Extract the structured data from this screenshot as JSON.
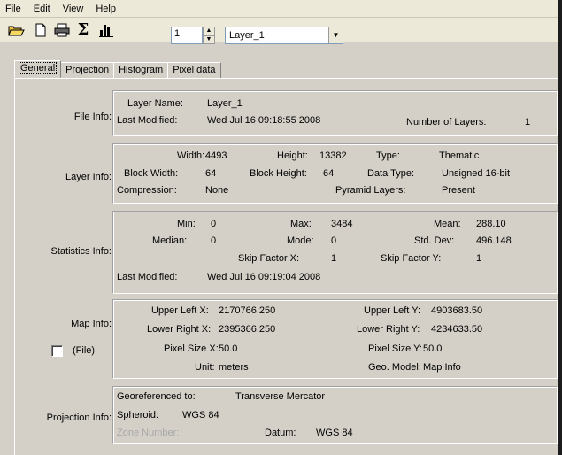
{
  "menu": [
    "File",
    "Edit",
    "View",
    "Help"
  ],
  "toolbar": {
    "open_icon": "open-folder-icon",
    "new_icon": "new-document-icon",
    "print_icon": "print-icon",
    "sigma": "Σ",
    "histogram_icon": "histogram-icon",
    "layer_number": "1",
    "layer_select": "Layer_1"
  },
  "tabs": [
    "General",
    "Projection",
    "Histogram",
    "Pixel data"
  ],
  "file_info": {
    "section": "File Info:",
    "layer_name_label": "Layer Name:",
    "layer_name": "Layer_1",
    "last_modified_label": "Last Modified:",
    "last_modified": "Wed Jul 16 09:18:55 2008",
    "num_layers_label": "Number of Layers:",
    "num_layers": "1"
  },
  "layer_info": {
    "section": "Layer Info:",
    "width_label": "Width:",
    "width": "4493",
    "height_label": "Height:",
    "height": "13382",
    "type_label": "Type:",
    "type": "Thematic",
    "block_width_label": "Block Width:",
    "block_width": "64",
    "block_height_label": "Block Height:",
    "block_height": "64",
    "data_type_label": "Data Type:",
    "data_type": "Unsigned 16-bit",
    "compression_label": "Compression:",
    "compression": "None",
    "pyramid_label": "Pyramid Layers:",
    "pyramid": "Present"
  },
  "stats_info": {
    "section": "Statistics Info:",
    "min_label": "Min:",
    "min": "0",
    "max_label": "Max:",
    "max": "3484",
    "mean_label": "Mean:",
    "mean": "288.10",
    "median_label": "Median:",
    "median": "0",
    "mode_label": "Mode:",
    "mode": "0",
    "std_label": "Std. Dev:",
    "std": "496.148",
    "skip_x_label": "Skip Factor X:",
    "skip_x": "1",
    "skip_y_label": "Skip Factor Y:",
    "skip_y": "1",
    "last_modified_label": "Last Modified:",
    "last_modified": "Wed Jul 16 09:19:04 2008"
  },
  "map_info": {
    "section": "Map Info:",
    "file_check_label": "(File)",
    "ulx_label": "Upper Left X:",
    "ulx": "2170766.250",
    "uly_label": "Upper Left Y:",
    "uly": "4903683.50",
    "lrx_label": "Lower Right X:",
    "lrx": "2395366.250",
    "lry_label": "Lower Right Y:",
    "lry": "4234633.50",
    "psx_label": "Pixel Size X:",
    "psx": "50.0",
    "psy_label": "Pixel Size Y:",
    "psy": "50.0",
    "unit_label": "Unit:",
    "unit": "meters",
    "geo_label": "Geo. Model:",
    "geo": "Map Info"
  },
  "proj_info": {
    "section": "Projection Info:",
    "georef_label": "Georeferenced to:",
    "georef": "Transverse Mercator",
    "spheroid_label": "Spheroid:",
    "spheroid": "WGS 84",
    "zone_label": "Zone Number:",
    "datum_label": "Datum:",
    "datum": "WGS 84"
  }
}
